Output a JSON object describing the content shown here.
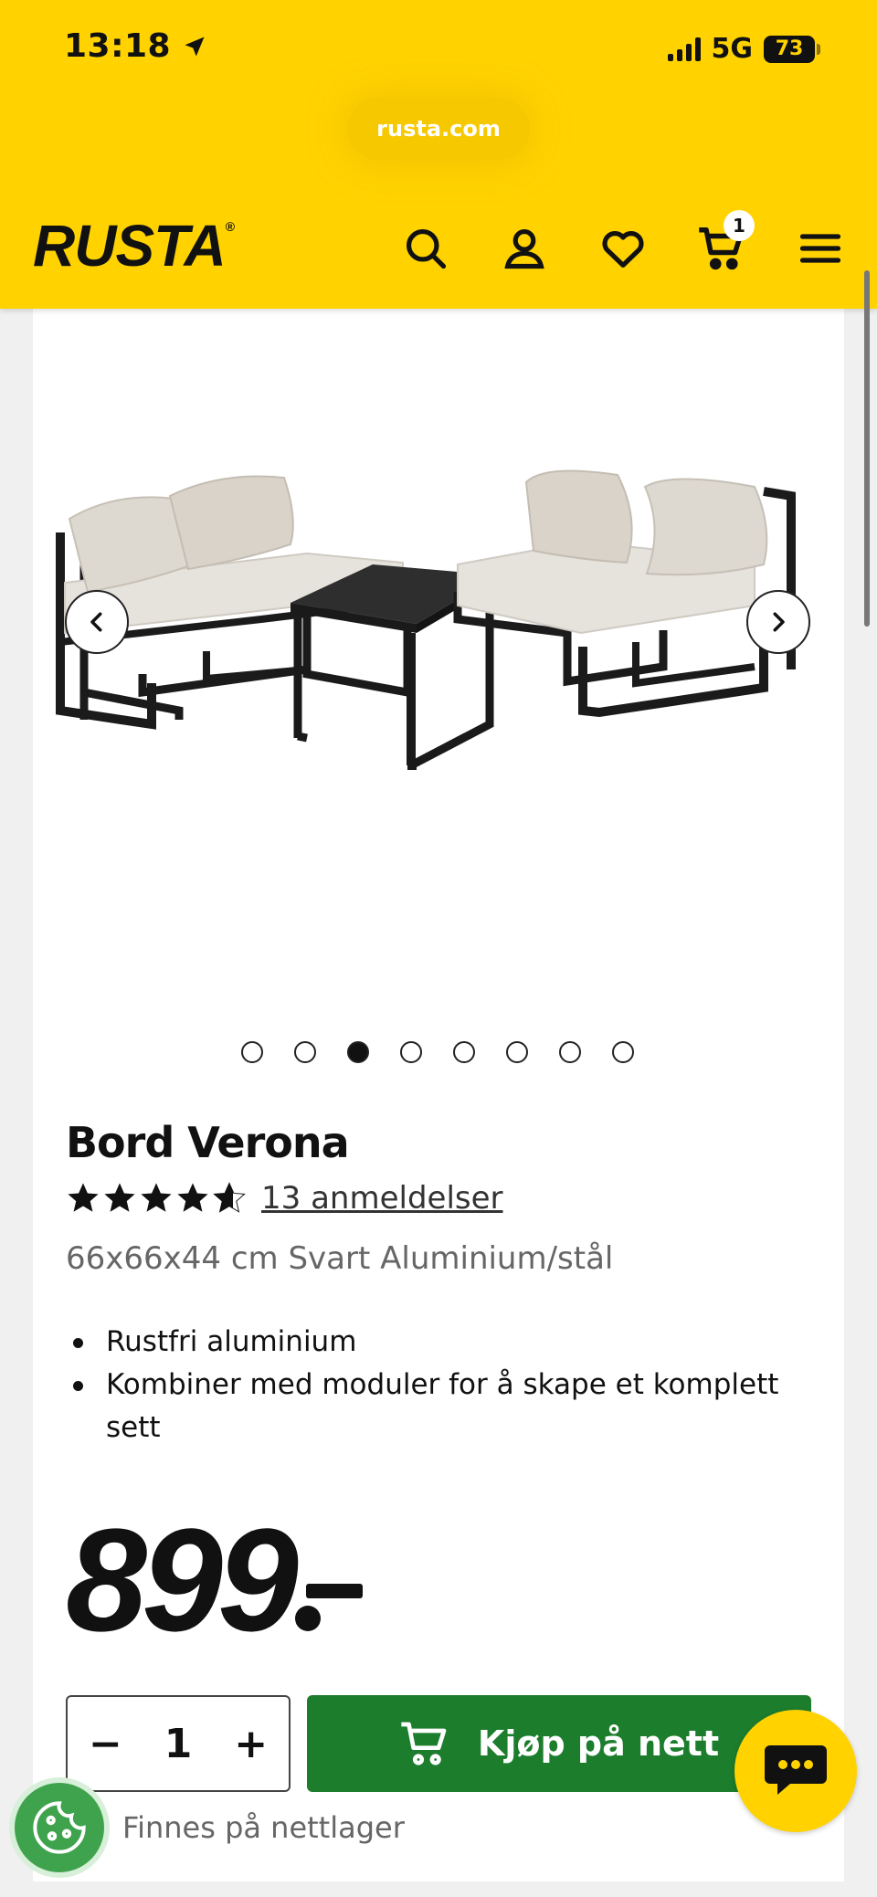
{
  "status_bar": {
    "time": "13:18",
    "network": "5G",
    "battery": "73"
  },
  "browser": {
    "url": "rusta.com"
  },
  "header": {
    "logo": "RUSTA",
    "cart_count": "1"
  },
  "gallery": {
    "total_images": 8,
    "active_index": 2
  },
  "product": {
    "title": "Bord Verona",
    "rating": 4.5,
    "reviews": "13 anmeldelser",
    "subtitle": "66x66x44 cm Svart Aluminium/stål",
    "bullets": [
      "Rustfri aluminium",
      "Kombiner med moduler for å skape et komplett sett"
    ],
    "price": "899"
  },
  "purchase": {
    "quantity": "1",
    "buy_label": "Kjøp på nett",
    "availability": "Finnes på nettlager"
  },
  "colors": {
    "brand_yellow": "#ffd200",
    "buy_green": "#1c7d2d"
  }
}
